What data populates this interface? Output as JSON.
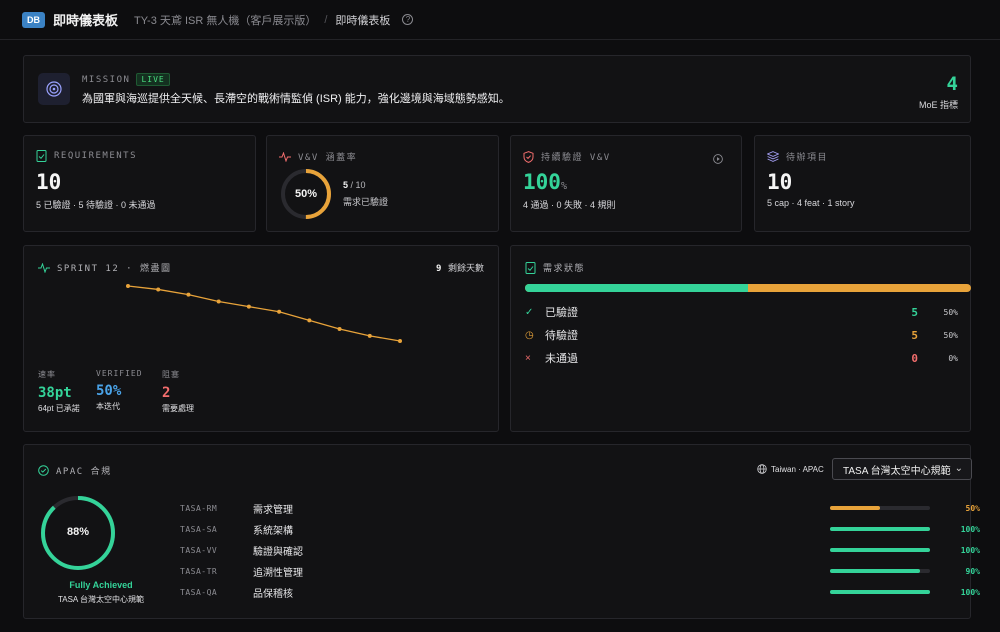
{
  "header": {
    "badge": "DB",
    "title": "即時儀表板",
    "breadcrumb_project": "TY-3 天鳶 ISR 無人機（客戶展示版）",
    "breadcrumb_sep": "/",
    "breadcrumb_current": "即時儀表板",
    "help": "?"
  },
  "mission": {
    "label": "MISSION",
    "live": "LIVE",
    "text": "為國軍與海巡提供全天候、長滯空的戰術情監偵 (ISR) 能力，強化邊境與海域態勢感知。",
    "moe_count": "4",
    "moe_label": "MoE 指標"
  },
  "requirements": {
    "label": "REQUIREMENTS",
    "value": "10",
    "summary": "5 已驗證 · 5 待驗證 · 0 未通過"
  },
  "vv_coverage": {
    "label": "V&V 涵蓋率",
    "percent_text": "50%",
    "percent": 0.5,
    "count_main": "5",
    "count_total": "/ 10",
    "caption": "需求已驗證"
  },
  "continuous_vv": {
    "label": "持續驗證 V&V",
    "value": "100",
    "unit": "%",
    "summary": "4 通過 · 0 失敗 · 4 規則"
  },
  "backlog": {
    "label": "待辦項目",
    "value": "10",
    "summary": "5 cap · 4 feat · 1 story"
  },
  "sprint": {
    "label": "SPRINT 12 · 燃盡圖",
    "days_num": "9",
    "days_label": "剩餘天數",
    "stats": [
      {
        "label": "速率",
        "value": "38pt",
        "caption": "64pt 已承諾",
        "color": "#34d399"
      },
      {
        "label": "VERIFIED",
        "value": "50%",
        "caption": "本迭代",
        "color": "#4aa3e8"
      },
      {
        "label": "阻塞",
        "value": "2",
        "caption": "需要處理",
        "color": "#f26d6d"
      }
    ]
  },
  "chart_data": {
    "type": "line",
    "title": "",
    "xlabel": "",
    "ylabel": "",
    "x": [
      1,
      2,
      3,
      4,
      5,
      6,
      7,
      8,
      9,
      10
    ],
    "values": [
      64,
      62,
      59,
      55,
      52,
      49,
      44,
      39,
      35,
      32
    ],
    "ylim": [
      0,
      64
    ],
    "color": "#e8a33a",
    "grid": false
  },
  "req_status": {
    "label": "需求狀態",
    "verified_fraction": 0.5,
    "rows": [
      {
        "icon": "✓",
        "name": "已驗證",
        "count": "5",
        "pct": "50%",
        "color": "#34d399"
      },
      {
        "icon": "◷",
        "name": "待驗證",
        "count": "5",
        "pct": "50%",
        "color": "#e8a33a"
      },
      {
        "icon": "×",
        "name": "未通過",
        "count": "0",
        "pct": "0%",
        "color": "#f26d6d"
      }
    ]
  },
  "compliance": {
    "label": "APAC 合規",
    "region": "Taiwan · APAC",
    "selected_standard": "TASA 台灣太空中心規範",
    "ring_percent_text": "88%",
    "ring_percent": 0.88,
    "status": "Fully Achieved",
    "standard_name": "TASA 台灣太空中心規範",
    "rows": [
      {
        "code": "TASA-RM",
        "name": "需求管理",
        "pct": "50%",
        "value": 0.5,
        "color": "#e8a33a"
      },
      {
        "code": "TASA-SA",
        "name": "系統架構",
        "pct": "100%",
        "value": 1.0,
        "color": "#34d399"
      },
      {
        "code": "TASA-VV",
        "name": "驗證與確認",
        "pct": "100%",
        "value": 1.0,
        "color": "#34d399"
      },
      {
        "code": "TASA-TR",
        "name": "追溯性管理",
        "pct": "90%",
        "value": 0.9,
        "color": "#34d399"
      },
      {
        "code": "TASA-QA",
        "name": "品保稽核",
        "pct": "100%",
        "value": 1.0,
        "color": "#34d399"
      }
    ]
  },
  "colors": {
    "accent_green": "#34d399",
    "accent_amber": "#e8a33a",
    "accent_red": "#f26d6d",
    "accent_blue": "#4aa3e8"
  }
}
